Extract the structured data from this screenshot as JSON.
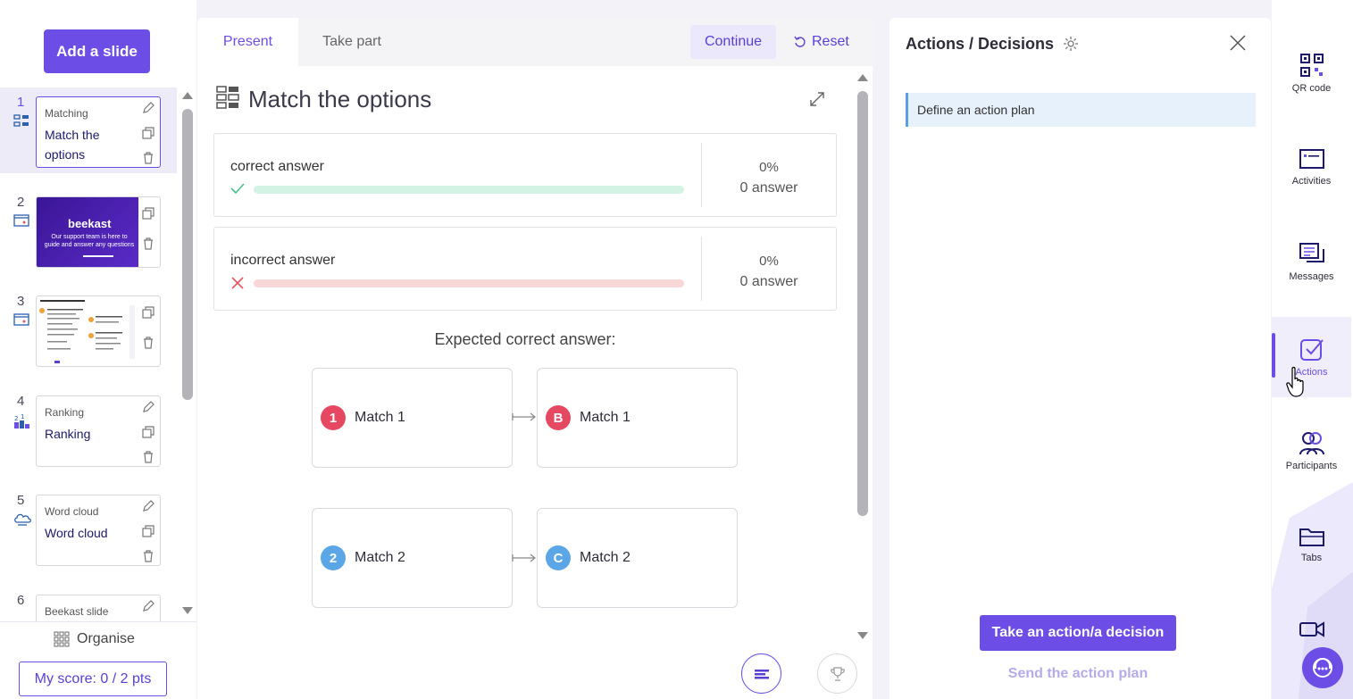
{
  "colors": {
    "accent": "#6c4de6",
    "correct": "#44c08a",
    "incorrect": "#e2565f",
    "badge_red": "#e54860",
    "badge_blue": "#5aa6e6"
  },
  "left": {
    "add_slide": "Add a slide",
    "slides": [
      {
        "num": "1",
        "kind": "Matching",
        "title": "Match the options"
      },
      {
        "num": "2",
        "thumb_brand": "beekast",
        "thumb_text": "Our support team is here to guide and answer any questions"
      },
      {
        "num": "3"
      },
      {
        "num": "4",
        "kind": "Ranking",
        "title": "Ranking"
      },
      {
        "num": "5",
        "kind": "Word cloud",
        "title": "Word cloud"
      },
      {
        "num": "6",
        "kind": "Beekast slide"
      }
    ],
    "organise": "Organise",
    "score": "My score: 0 / 2 pts"
  },
  "center": {
    "tabs": {
      "present": "Present",
      "take_part": "Take part"
    },
    "continue": "Continue",
    "reset": "Reset",
    "question_title": "Match the options",
    "answers": [
      {
        "label": "correct answer",
        "pct": "0%",
        "count": "0 answer",
        "fill": 0
      },
      {
        "label": "incorrect answer",
        "pct": "0%",
        "count": "0 answer",
        "fill": 0
      }
    ],
    "expected_label": "Expected correct answer:",
    "pairs": [
      {
        "left_badge": "1",
        "left_text": "Match 1",
        "right_badge": "B",
        "right_text": "Match 1"
      },
      {
        "left_badge": "2",
        "left_text": "Match 2",
        "right_badge": "C",
        "right_text": "Match 2"
      }
    ]
  },
  "right": {
    "title": "Actions / Decisions",
    "plan_item": "Define an action plan",
    "take_action": "Take an action/a decision",
    "send_plan": "Send the action plan"
  },
  "rail": {
    "qr": "QR code",
    "activities": "Activities",
    "messages": "Messages",
    "actions": "Actions",
    "participants": "Participants",
    "tabs": "Tabs"
  }
}
